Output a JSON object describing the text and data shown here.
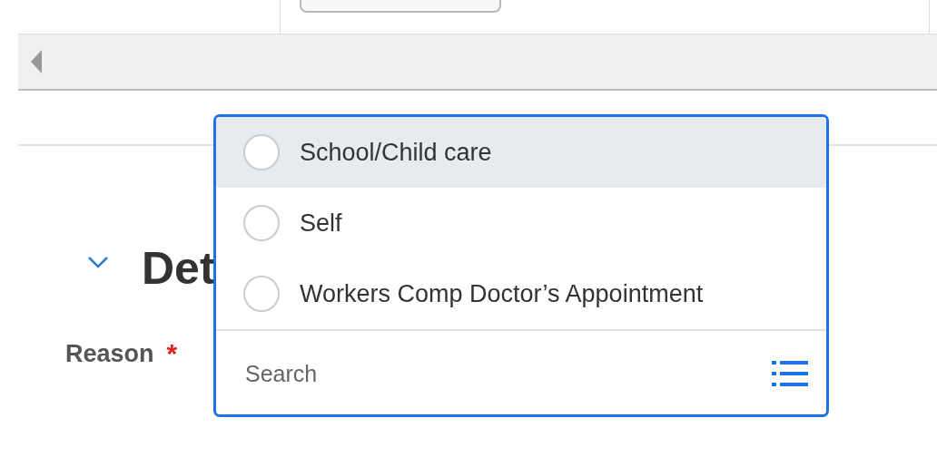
{
  "section": {
    "title": "Det",
    "expanded": true
  },
  "field": {
    "label": "Reason",
    "required": true,
    "required_marker": "*"
  },
  "dropdown": {
    "options": [
      {
        "label": "School/Child care",
        "highlighted": true,
        "selected": false
      },
      {
        "label": "Self",
        "highlighted": false,
        "selected": false
      },
      {
        "label": "Workers Comp Doctor’s Appointment",
        "highlighted": false,
        "selected": false
      }
    ],
    "search": {
      "placeholder": "Search"
    }
  }
}
